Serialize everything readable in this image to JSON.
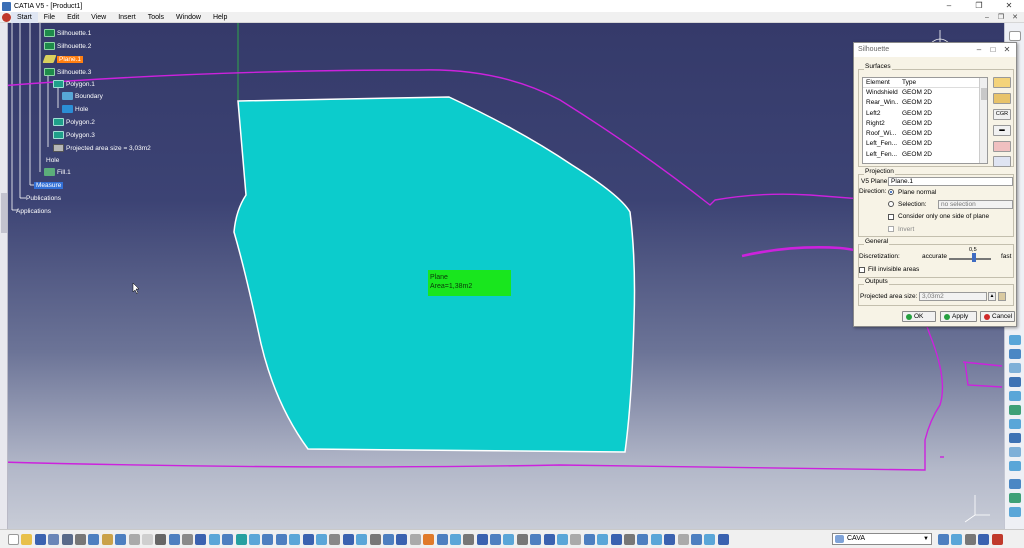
{
  "window": {
    "title": "CATIA V5 - [Product1]"
  },
  "menu": {
    "items": [
      "Start",
      "File",
      "Edit",
      "View",
      "Insert",
      "Tools",
      "Window",
      "Help"
    ]
  },
  "tree": {
    "items": [
      {
        "label": "Silhouette.1"
      },
      {
        "label": "Silhouette.2"
      },
      {
        "label": "Plane.1"
      },
      {
        "label": "Silhouette.3"
      },
      {
        "label": "Polygon.1"
      },
      {
        "label": "Boundary"
      },
      {
        "label": "Hole"
      },
      {
        "label": "Polygon.2"
      },
      {
        "label": "Polygon.3"
      },
      {
        "label": "Projected area size = 3,03m2"
      },
      {
        "label": "Hole"
      },
      {
        "label": "Fill.1"
      },
      {
        "label": "Measure"
      },
      {
        "label": "Publications"
      },
      {
        "label": "Applications"
      }
    ]
  },
  "viewport": {
    "plane_label": {
      "line1": "Plane",
      "line2": "Area=1,38m2"
    },
    "colors": {
      "plane_fill": "#0ccccc",
      "curve": "#cc22dd",
      "label_bg": "#19e61e"
    }
  },
  "dialog": {
    "title": "Silhouette",
    "surfaces": {
      "label": "Surfaces",
      "headers": [
        "Element",
        "Type"
      ],
      "rows": [
        {
          "element": "Windshield",
          "type": "GEOM 2D"
        },
        {
          "element": "Rear_Win...",
          "type": "GEOM 2D"
        },
        {
          "element": "Left2",
          "type": "GEOM 2D"
        },
        {
          "element": "Right2",
          "type": "GEOM 2D"
        },
        {
          "element": "Roof_Wi...",
          "type": "GEOM 2D"
        },
        {
          "element": "Left_Fen...",
          "type": "GEOM 2D"
        },
        {
          "element": "Left_Fen...",
          "type": "GEOM 2D"
        }
      ],
      "side_button": "CGR"
    },
    "projection": {
      "label": "Projection",
      "v5_plane_label": "V5 Plane:",
      "v5_plane_value": "Plane.1",
      "direction_label": "Direction:",
      "plane_normal": "Plane normal",
      "selection": "Selection:",
      "selection_value": "no selection",
      "one_side": "Consider only one side of plane",
      "invert": "Invert"
    },
    "general": {
      "label": "General",
      "discretization": "Discretization:",
      "accurate": "accurate",
      "fast": "fast",
      "slider_value": "0,5",
      "fill_invisible": "Fill invisible areas"
    },
    "outputs": {
      "label": "Outputs",
      "projected_area_label": "Projected area size:",
      "projected_area_value": "3,03m2"
    },
    "buttons": {
      "ok": "OK",
      "apply": "Apply",
      "cancel": "Cancel"
    }
  },
  "bottom_toolbar": {
    "workbench_select": "CAVA"
  }
}
